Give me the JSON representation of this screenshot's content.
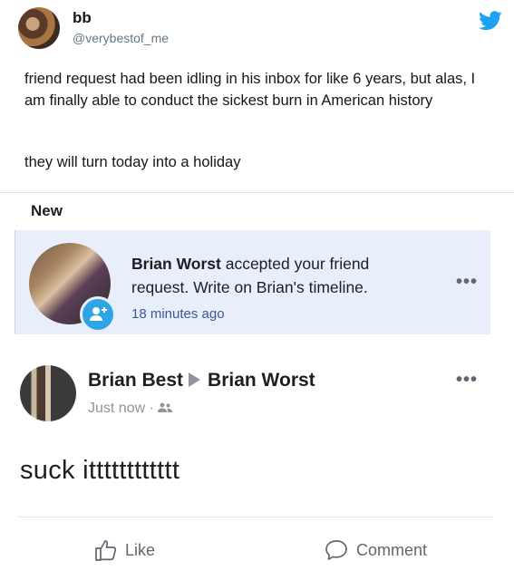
{
  "tweet": {
    "name": "bb",
    "handle": "@verybestof_me",
    "text": "friend request had been idling in his inbox for like 6 years, but alas, I am finally able to conduct the sickest burn in American history",
    "text2": "they will turn today into a holiday",
    "logo_icon": "twitter-bird-icon",
    "brand_color": "#1da1f2"
  },
  "notification": {
    "section_label": "New",
    "actor": "Brian Worst",
    "message": " accepted your friend request. Write on Brian's timeline.",
    "time": "18 minutes ago",
    "more_icon": "more-dots-icon",
    "badge_icon": "add-friend-icon"
  },
  "post": {
    "author": "Brian Best",
    "target": "Brian Worst",
    "time": "Just now",
    "separator": "·",
    "privacy_icon": "friends-icon",
    "body": "suck itttttttttttt",
    "like_label": "Like",
    "comment_label": "Comment",
    "more_icon": "more-dots-icon"
  }
}
